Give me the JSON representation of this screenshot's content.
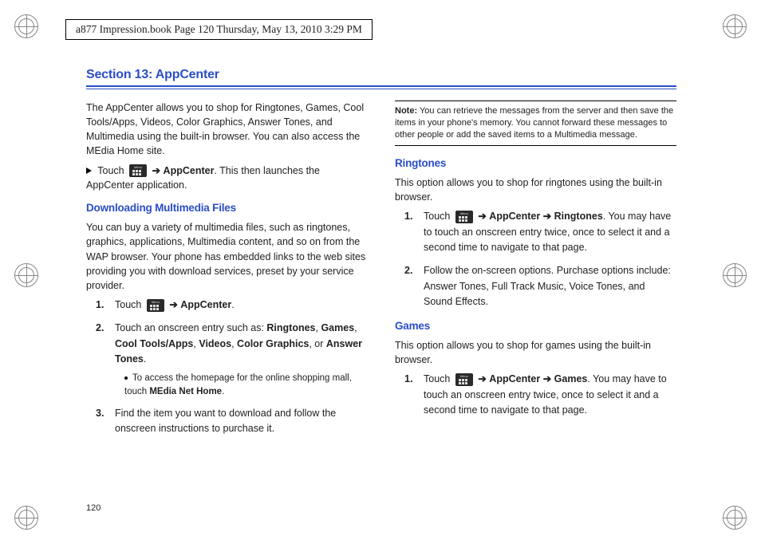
{
  "header_stamp": "a877 Impression.book  Page 120  Thursday, May 13, 2010  3:29 PM",
  "section_title": "Section 13: AppCenter",
  "page_number": "120",
  "left": {
    "intro": "The AppCenter allows you to shop for Ringtones, Games, Cool Tools/Apps, Videos, Color Graphics, Answer Tones, and Multimedia using the built-in browser. You can also access the MEdia Home site.",
    "touch_label": "Touch",
    "appcenter_bold": "AppCenter",
    "touch_tail": ". This then launches the AppCenter application.",
    "sub1": "Downloading Multimedia Files",
    "sub1_body": "You can buy a variety of multimedia files, such as ringtones, graphics, applications, Multimedia content, and so on from the WAP browser. Your phone has embedded links to the web sites providing you with download services, preset by your service provider.",
    "step1_pre": "Touch",
    "step1_bold": "AppCenter",
    "step1_post": ".",
    "step2_pre": "Touch an onscreen entry such as: ",
    "step2_b1": "Ringtones",
    "step2_b2": "Games",
    "step2_b3": "Cool Tools/Apps",
    "step2_b4": "Videos",
    "step2_b5": "Color Graphics",
    "step2_or": ", or ",
    "step2_b6": "Answer Tones",
    "step2_post": ".",
    "sub_bullet_pre": "To access the homepage for the online shopping mall, touch ",
    "sub_bullet_b": "MEdia Net Home",
    "sub_bullet_post": ".",
    "step3": "Find the item you want to download and follow the onscreen instructions to purchase it."
  },
  "right": {
    "note_label": "Note:",
    "note_body": " You can retrieve the messages from the server and then save the items in your phone's memory. You cannot forward these messages to other people or add the saved items to a Multimedia message.",
    "ring_h": "Ringtones",
    "ring_body": "This option allows you to shop for ringtones using the built-in browser.",
    "ring_s1_pre": "Touch",
    "ring_s1_b1": "AppCenter",
    "ring_s1_b2": "Ringtones",
    "ring_s1_post": ". You may have to touch an onscreen entry twice, once to select it and a second time to navigate to that page.",
    "ring_s2": "Follow the on-screen options. Purchase options include: Answer Tones, Full Track Music, Voice Tones, and Sound Effects.",
    "games_h": "Games",
    "games_body": "This option allows you to shop for games using the built-in browser.",
    "games_s1_pre": "Touch",
    "games_s1_b1": "AppCenter",
    "games_s1_b2": "Games",
    "games_s1_post": ". You may have to touch an onscreen entry twice, once to select it and a second time to navigate to that page."
  },
  "arrow": "➔"
}
